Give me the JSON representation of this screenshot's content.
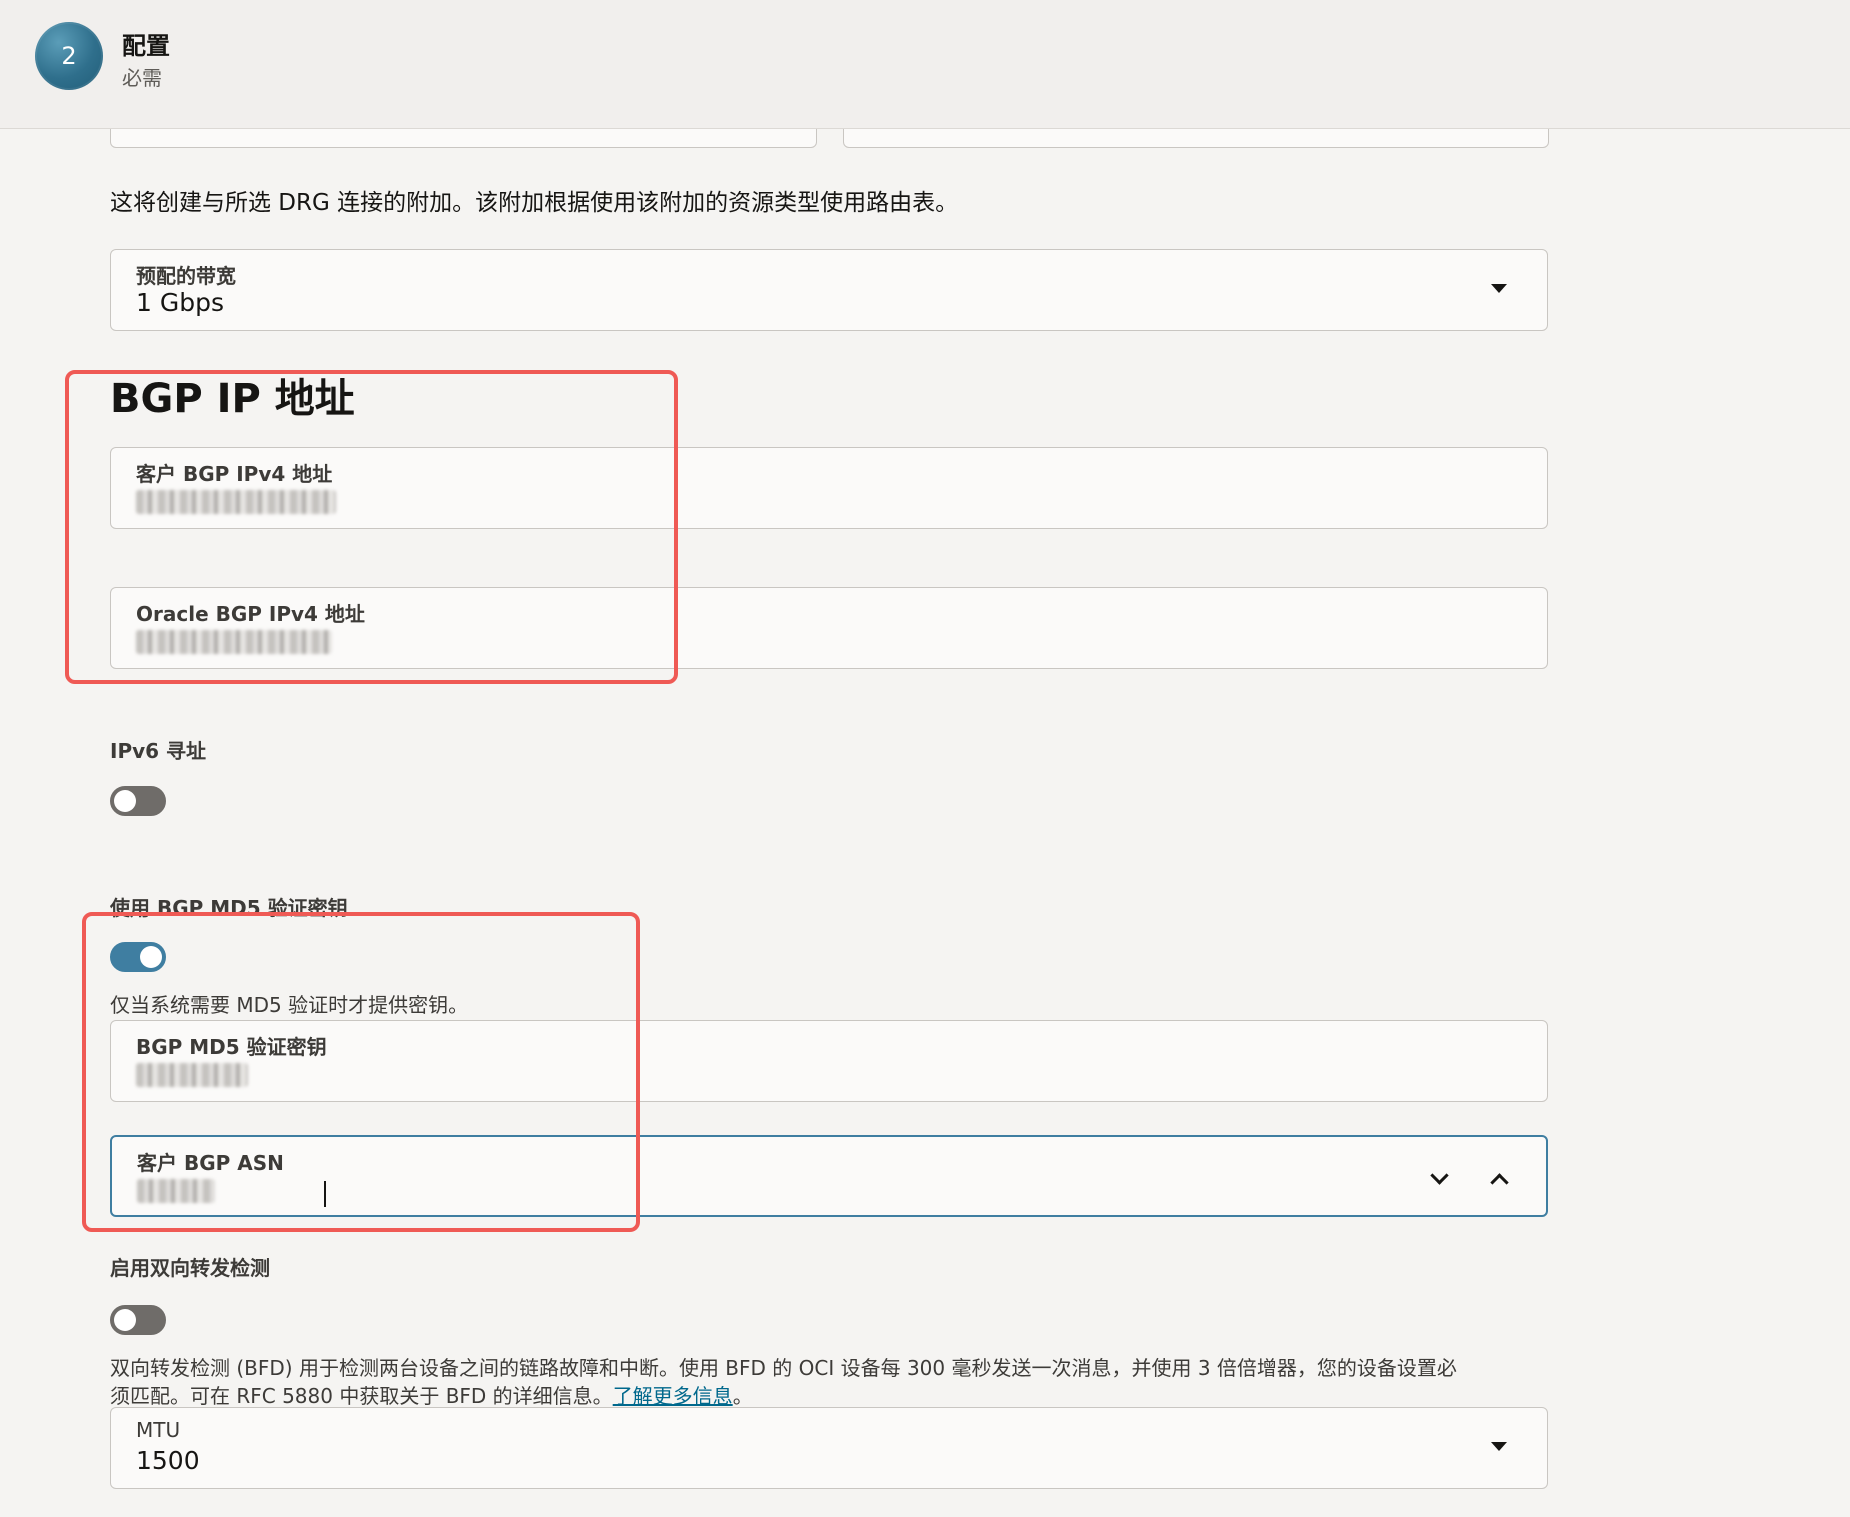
{
  "header": {
    "step_number": "2",
    "title": "配置",
    "subtitle": "必需"
  },
  "drg_description": "这将创建与所选 DRG 连接的附加。该附加根据使用该附加的资源类型使用路由表。",
  "bandwidth": {
    "label": "预配的带宽",
    "value": "1 Gbps"
  },
  "bgp_section": {
    "title": "BGP IP 地址",
    "customer_ipv4_label": "客户 BGP IPv4 地址",
    "oracle_ipv4_label": "Oracle BGP IPv4 地址"
  },
  "ipv6": {
    "label": "IPv6 寻址",
    "enabled": false
  },
  "md5": {
    "label": "使用 BGP MD5 验证密钥",
    "enabled": true,
    "help": "仅当系统需要 MD5 验证时才提供密钥。",
    "key_label": "BGP MD5 验证密钥"
  },
  "asn": {
    "label": "客户 BGP ASN"
  },
  "bfd": {
    "label": "启用双向转发检测",
    "enabled": false,
    "help_line1": "双向转发检测 (BFD) 用于检测两台设备之间的链路故障和中断。使用 BFD 的 OCI 设备每 300 毫秒发送一次消息，并使用 3 倍倍增器，您的设备设置必",
    "help_line2": "须匹配。可在 RFC 5880 中获取关于 BFD 的详细信息。",
    "link_text": "了解更多信息",
    "after_link": "。"
  },
  "mtu": {
    "label": "MTU",
    "value": "1500"
  },
  "colors": {
    "accent": "#3f7ea1",
    "highlight": "#ef5a55",
    "link": "#00688c"
  },
  "icons": [
    "caret-down-icon",
    "chevron-down-icon",
    "chevron-up-icon"
  ]
}
